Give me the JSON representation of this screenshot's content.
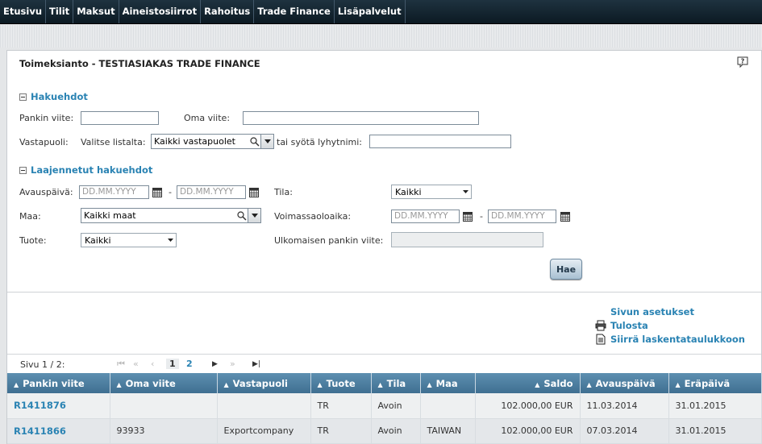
{
  "nav": {
    "items": [
      "Etusivu",
      "Tilit",
      "Maksut",
      "Aineistosiirrot",
      "Rahoitus",
      "Trade Finance",
      "Lisäpalvelut"
    ]
  },
  "page": {
    "title": "Toimeksianto - TESTIASIAKAS TRADE FINANCE"
  },
  "search": {
    "heading": "Hakuehdot",
    "bank_ref_label": "Pankin viite:",
    "bank_ref_value": "",
    "own_ref_label": "Oma viite:",
    "own_ref_value": "",
    "counterparty_label": "Vastapuoli:",
    "select_from_list_label": "Valitse listalta:",
    "counterparty_select": "Kaikki vastapuolet",
    "or_enter_short_label": "tai syötä lyhytnimi:",
    "short_name_value": ""
  },
  "extended": {
    "heading": "Laajennetut hakuehdot",
    "open_date_label": "Avauspäivä:",
    "date_placeholder": "DD.MM.YYYY",
    "status_label": "Tila:",
    "status_value": "Kaikki",
    "country_label": "Maa:",
    "country_value": "Kaikki maat",
    "validity_label": "Voimassaoloaika:",
    "product_label": "Tuote:",
    "product_value": "Kaikki",
    "foreign_bank_ref_label": "Ulkomaisen pankin viite:",
    "foreign_bank_ref_value": "",
    "search_button": "Hae"
  },
  "side_links": {
    "page_settings": "Sivun asetukset",
    "print": "Tulosta",
    "export": "Siirrä laskentataulukkoon"
  },
  "pager": {
    "text": "Sivu 1 / 2:",
    "pages": [
      "1",
      "2"
    ]
  },
  "table": {
    "columns": [
      "Pankin viite",
      "Oma viite",
      "Vastapuoli",
      "Tuote",
      "Tila",
      "Maa",
      "Saldo",
      "Avauspäivä",
      "Eräpäivä"
    ],
    "rows": [
      [
        "R1411876",
        "",
        "",
        "TR",
        "Avoin",
        "",
        "102.000,00 EUR",
        "11.03.2014",
        "31.01.2015"
      ],
      [
        "R1411866",
        "93933",
        "Exportcompany",
        "TR",
        "Avoin",
        "TAIWAN",
        "102.000,00 EUR",
        "07.03.2014",
        "31.01.2015"
      ]
    ]
  }
}
